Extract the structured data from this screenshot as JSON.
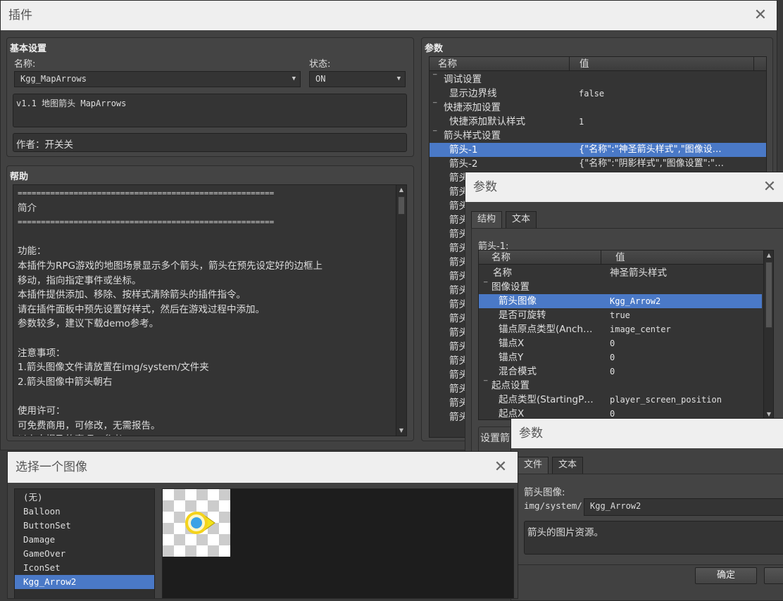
{
  "main_window": {
    "title": "插件",
    "basic": {
      "title": "基本设置",
      "name_label": "名称:",
      "name_value": "Kgg_MapArrows",
      "status_label": "状态:",
      "status_value": "ON",
      "description": "v1.1 地图箭头 MapArrows",
      "author": "作者：开关关"
    },
    "help": {
      "title": "帮助",
      "lines": [
        "=======================================================",
        "简介",
        "=======================================================",
        "",
        "功能：",
        "本插件为RPG游戏的地图场景显示多个箭头，箭头在预先设定好的边框上",
        "移动，指向指定事件或坐标。",
        "本插件提供添加、移除、按样式清除箭头的插件指令。",
        "请在插件面板中预先设置好样式，然后在游戏过程中添加。",
        "参数较多，建议下载demo参考。",
        "",
        "注意事项：",
        "1.箭头图像文件请放置在img/system/文件夹",
        "2.箭头图像中箭头朝右",
        "",
        "使用许可：",
        "可免费商用，可修改，无需报告。",
        "以上未提及的事项，参考MIT License。"
      ]
    },
    "params": {
      "title": "参数",
      "col_name": "名称",
      "col_value": "值",
      "rows": [
        {
          "name": "调试设置",
          "value": "",
          "group": true
        },
        {
          "name": "显示边界线",
          "value": "false",
          "group": false
        },
        {
          "name": "快捷添加设置",
          "value": "",
          "group": true
        },
        {
          "name": "快捷添加默认样式",
          "value": "1",
          "group": false
        },
        {
          "name": "箭头样式设置",
          "value": "",
          "group": true
        },
        {
          "name": "箭头-1",
          "value": "{\"名称\":\"神圣箭头样式\",\"图像设…",
          "group": false,
          "selected": true
        },
        {
          "name": "箭头-2",
          "value": "{\"名称\":\"阴影样式\",\"图像设置\":\"…",
          "group": false
        },
        {
          "name": "箭头",
          "value": "",
          "group": false
        },
        {
          "name": "箭头",
          "value": "",
          "group": false
        },
        {
          "name": "箭头",
          "value": "",
          "group": false
        },
        {
          "name": "箭头",
          "value": "",
          "group": false
        },
        {
          "name": "箭头",
          "value": "",
          "group": false
        },
        {
          "name": "箭头",
          "value": "",
          "group": false
        },
        {
          "name": "箭头",
          "value": "",
          "group": false
        },
        {
          "name": "箭头",
          "value": "",
          "group": false
        },
        {
          "name": "箭头",
          "value": "",
          "group": false
        },
        {
          "name": "箭头",
          "value": "",
          "group": false
        },
        {
          "name": "箭头",
          "value": "",
          "group": false
        },
        {
          "name": "箭头",
          "value": "",
          "group": false
        },
        {
          "name": "箭头",
          "value": "",
          "group": false
        },
        {
          "name": "箭头",
          "value": "",
          "group": false
        },
        {
          "name": "箭头",
          "value": "",
          "group": false
        },
        {
          "name": "箭头",
          "value": "",
          "group": false
        },
        {
          "name": "箭头",
          "value": "",
          "group": false
        },
        {
          "name": "箭头",
          "value": "",
          "group": false
        }
      ]
    }
  },
  "param_dialog": {
    "title": "参数",
    "tabs": [
      "结构",
      "文本"
    ],
    "node_label": "箭头-1:",
    "col_name": "名称",
    "col_value": "值",
    "rows": [
      {
        "name": "名称",
        "value": "神圣箭头样式",
        "indent": 1,
        "group": false
      },
      {
        "name": "图像设置",
        "value": "",
        "indent": 0,
        "group": true
      },
      {
        "name": "箭头图像",
        "value": "Kgg_Arrow2",
        "indent": 2,
        "group": false,
        "selected": true
      },
      {
        "name": "是否可旋转",
        "value": "true",
        "indent": 2,
        "group": false
      },
      {
        "name": "锚点原点类型(Anch…",
        "value": "image_center",
        "indent": 2,
        "group": false
      },
      {
        "name": "锚点X",
        "value": "0",
        "indent": 2,
        "group": false
      },
      {
        "name": "锚点Y",
        "value": "0",
        "indent": 2,
        "group": false
      },
      {
        "name": "混合模式",
        "value": "0",
        "indent": 2,
        "group": false
      },
      {
        "name": "起点设置",
        "value": "",
        "indent": 0,
        "group": true
      },
      {
        "name": "起点类型(StartingP…",
        "value": "player_screen_position",
        "indent": 2,
        "group": false
      },
      {
        "name": "起点X",
        "value": "0",
        "indent": 2,
        "group": false
      }
    ],
    "partial_label": "设置箭"
  },
  "file_dialog": {
    "title": "参数",
    "tabs": [
      "文件",
      "文本"
    ],
    "field_label": "箭头图像:",
    "path_prefix": "img/system/",
    "file_value": "Kgg_Arrow2",
    "description": "箭头的图片资源。",
    "ok_label": "确定"
  },
  "image_picker": {
    "title": "选择一个图像",
    "items": [
      "(无)",
      "Balloon",
      "ButtonSet",
      "Damage",
      "GameOver",
      "IconSet",
      "Kgg_Arrow2"
    ],
    "selected_index": 6
  },
  "colors": {
    "selection": "#4a79c7",
    "dialog_bg": "#414141",
    "titlebar_bg": "#efefef"
  }
}
